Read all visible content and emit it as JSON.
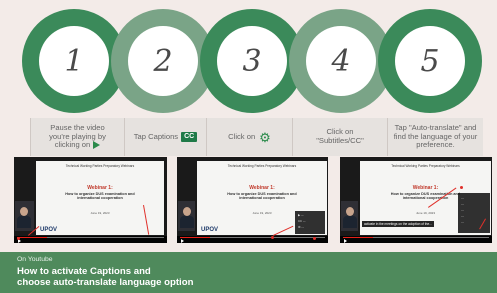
{
  "steps": [
    {
      "number": "1",
      "ring_color": "#3b8a5a",
      "label": "Pause the video you're playing by clicking on",
      "icon": "play-icon"
    },
    {
      "number": "2",
      "ring_color": "#7aa487",
      "label": "Tap Captions",
      "badge": "CC",
      "icon": "captions-icon"
    },
    {
      "number": "3",
      "ring_color": "#3b8a5a",
      "label": "Click on",
      "icon": "gear-icon"
    },
    {
      "number": "4",
      "ring_color": "#7aa487",
      "label": "Click on \"Subtitles/CC\""
    },
    {
      "number": "5",
      "ring_color": "#3b8a5a",
      "label": "Tap \"Auto-translate\" and find the language of your preference."
    }
  ],
  "screenshots": [
    {
      "header": "Technical Working Parties Preparatory Webinars",
      "webinar_title": "Webinar 1:",
      "webinar_subtitle": "How to organize DUS examination and international cooperation",
      "date": "June 19, 2023",
      "logo": "UPOV"
    },
    {
      "header": "Technical Working Parties Preparatory Webinars",
      "webinar_title": "Webinar 1:",
      "webinar_subtitle": "How to organize DUS examination and international cooperation",
      "date": "June 19, 2023",
      "logo": "UPOV"
    },
    {
      "header": "Technical Working Parties Preparatory Webinars",
      "webinar_title": "Webinar 1:",
      "webinar_subtitle": "How to organize DUS examination and international cooperation",
      "date": "June 19, 2023",
      "logo": "UPOV",
      "caption": "activate in the meetings on the adoption of the..."
    }
  ],
  "footer": {
    "small": "On Youtube",
    "title_line1": "How to activate Captions and",
    "title_line2": "choose auto-translate language option"
  },
  "colors": {
    "accent_dark": "#3b8a5a",
    "accent_light": "#7aa487",
    "footer_bg": "#4f8a5c",
    "highlight_red": "#e0302a"
  }
}
